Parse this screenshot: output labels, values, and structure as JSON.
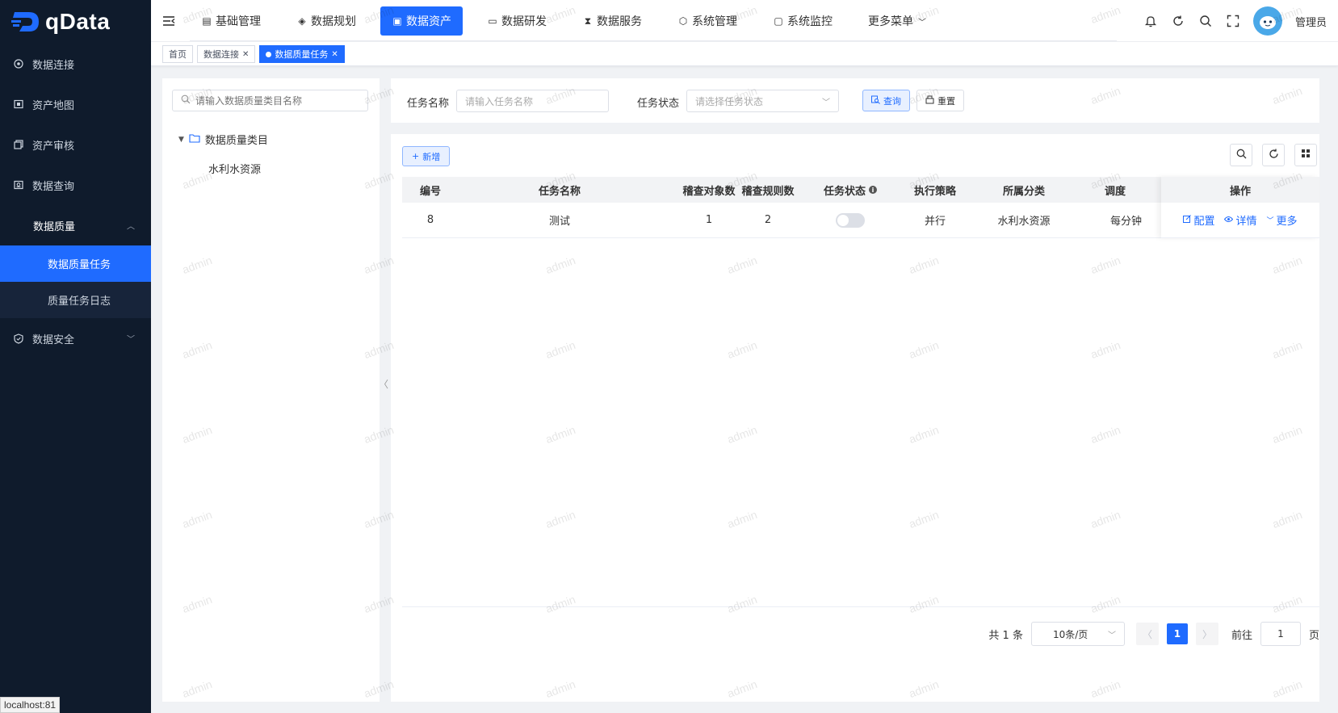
{
  "app": {
    "logo_text": "qData"
  },
  "sidebar": {
    "items": [
      {
        "label": "数据连接",
        "icon": "target-icon"
      },
      {
        "label": "资产地图",
        "icon": "map-icon"
      },
      {
        "label": "资产审核",
        "icon": "copy-icon"
      },
      {
        "label": "数据查询",
        "icon": "query-icon"
      }
    ],
    "quality_group": {
      "label": "数据质量",
      "sub_items": [
        {
          "label": "数据质量任务",
          "active": true
        },
        {
          "label": "质量任务日志",
          "active": false
        }
      ]
    },
    "security_item": {
      "label": "数据安全"
    }
  },
  "topnav": {
    "items": [
      {
        "label": "基础管理",
        "active": false
      },
      {
        "label": "数据规划",
        "active": false
      },
      {
        "label": "数据资产",
        "active": true
      },
      {
        "label": "数据研发",
        "active": false
      },
      {
        "label": "数据服务",
        "active": false
      },
      {
        "label": "系统管理",
        "active": false
      },
      {
        "label": "系统监控",
        "active": false
      },
      {
        "label": "更多菜单",
        "active": false
      }
    ],
    "user_name": "管理员"
  },
  "tabs": [
    {
      "label": "首页"
    },
    {
      "label": "数据连接"
    },
    {
      "label": "数据质量任务"
    }
  ],
  "tree": {
    "search_placeholder": "请输入数据质量类目名称",
    "root_label": "数据质量类目",
    "children": [
      "水利水资源"
    ]
  },
  "search": {
    "task_name_label": "任务名称",
    "task_name_placeholder": "请输入任务名称",
    "task_status_label": "任务状态",
    "task_status_placeholder": "请选择任务状态",
    "query_button": "查询",
    "reset_button": "重置"
  },
  "toolbar": {
    "add_button": "新增"
  },
  "table": {
    "headers": {
      "id": "编号",
      "name": "任务名称",
      "objects": "稽查对象数",
      "rules": "稽查规则数",
      "status": "任务状态",
      "strategy": "执行策略",
      "category": "所属分类",
      "schedule": "调度",
      "ops": "操作"
    },
    "rows": [
      {
        "id": "8",
        "name": "测试",
        "objects": "1",
        "rules": "2",
        "status_enabled": false,
        "strategy": "并行",
        "category": "水利水资源",
        "schedule": "每分钟"
      }
    ],
    "ops": {
      "config": "配置",
      "detail": "详情",
      "more": "更多"
    }
  },
  "pager": {
    "total_text": "共 1 条",
    "page_size": "10条/页",
    "current_page": "1",
    "goto_label": "前往",
    "goto_value": "1",
    "page_unit": "页"
  },
  "watermark": "admin",
  "status_bar": {
    "url": "localhost:81"
  },
  "colors": {
    "primary": "#1f6bff",
    "sidebar_bg": "#0f1b2c"
  }
}
